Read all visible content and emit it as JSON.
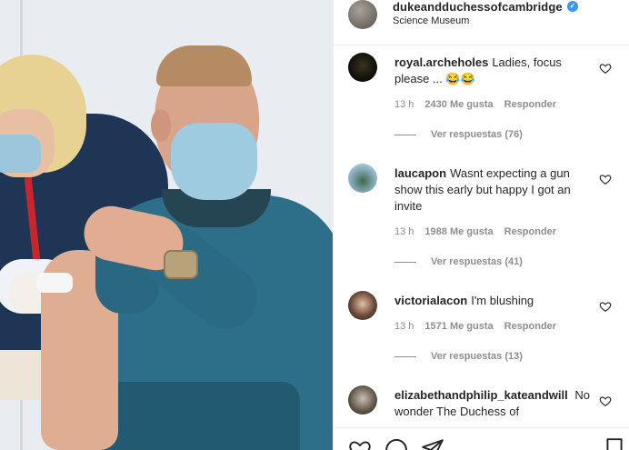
{
  "post": {
    "username": "dukeandduchessofcambridge",
    "location": "Science Museum",
    "verified": true
  },
  "comments": [
    {
      "user": "royal.archeholes",
      "text": "Ladies, focus please ... 😂😂",
      "time": "13 h",
      "likes": "2430 Me gusta",
      "reply": "Responder",
      "replies": "Ver respuestas (76)"
    },
    {
      "user": "laucapon",
      "text": "Wasnt expecting a gun show this early but happy I got an invite",
      "time": "13 h",
      "likes": "1988 Me gusta",
      "reply": "Responder",
      "replies": "Ver respuestas (41)"
    },
    {
      "user": "victorialacon",
      "text": "I'm blushing",
      "time": "13 h",
      "likes": "1571 Me gusta",
      "reply": "Responder",
      "replies": "Ver respuestas (13)"
    },
    {
      "user": "elizabethandphilip_kateandwill",
      "text": "No wonder The Duchess of"
    }
  ],
  "icons": {
    "heart": "heart-icon",
    "comment": "comment-icon",
    "share": "share-icon",
    "save": "bookmark-icon"
  },
  "colors": {
    "text": "#262626",
    "muted": "#8e8e8e",
    "verified": "#3897f0",
    "border": "#efefef"
  }
}
